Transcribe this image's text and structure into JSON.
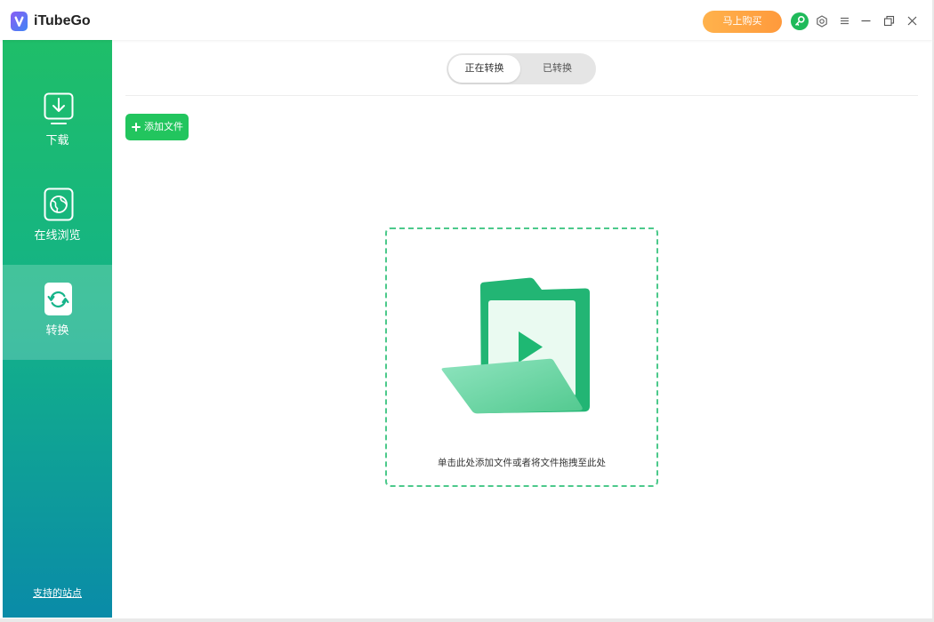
{
  "app": {
    "name": "iTubeGo",
    "logo_icon": "itubego-logo-icon"
  },
  "titlebar": {
    "buy_label": "马上购买",
    "icons": {
      "register": "key-icon",
      "settings": "gear-icon",
      "menu": "menu-icon",
      "minimize": "minimize-icon",
      "restore": "restore-icon",
      "close": "close-icon"
    }
  },
  "sidebar": {
    "items": [
      {
        "label": "下载",
        "icon": "download-icon",
        "selected": false
      },
      {
        "label": "在线浏览",
        "icon": "browser-icon",
        "selected": false
      },
      {
        "label": "转换",
        "icon": "convert-icon",
        "selected": true
      }
    ],
    "supported_sites_link": "支持的站点"
  },
  "main": {
    "tabs": [
      {
        "label": "正在转换",
        "selected": true
      },
      {
        "label": "已转换",
        "selected": false
      }
    ],
    "add_file_button": {
      "label": "添加文件",
      "icon": "plus-icon"
    },
    "drop_zone": {
      "hint": "单击此处添加文件或者将文件拖拽至此处",
      "illustration": "video-folder-icon"
    }
  },
  "colors": {
    "accent_green": "#22c55e",
    "buy_orange": "#ff9a3c",
    "sidebar_top": "#1fbe69",
    "sidebar_bottom": "#0a8ba8",
    "drop_border": "#4cc98b"
  }
}
